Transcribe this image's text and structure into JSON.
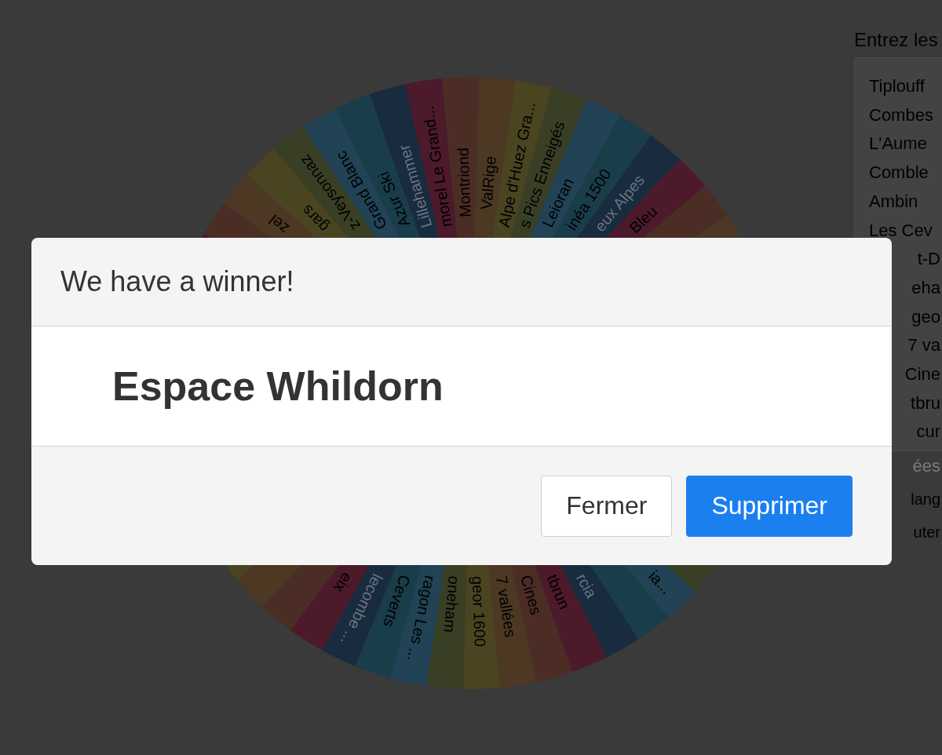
{
  "wheel": {
    "labels": [
      "zel",
      "gars",
      "z-Veysonnaz",
      "Grand Blanc",
      "Azur Ski",
      "Lillehammer",
      "morel Le Grand...",
      "Montriond",
      "ValRige",
      "Alpe d'Huez Gra...",
      "s Pics Enneigés",
      "Leioran",
      "inéa 1500",
      "eux Alpes",
      "Bleu",
      "eix",
      "lecombe ...",
      "Ceverts",
      "ragon Les ...",
      "oneham",
      "geor 1600",
      "7 vallées",
      "Cines",
      "tbrun",
      "rcia",
      "ia..."
    ]
  },
  "entries_panel": {
    "label": "Entrez les",
    "lines": [
      "Tiplouff",
      "Combes",
      "L'Aume",
      "Comble",
      "Ambin",
      "Les Cev",
      "t-D",
      "eha",
      "geo",
      "7 va",
      "Cine",
      "tbru",
      "cur"
    ],
    "hint": "ées",
    "options": [
      "lang",
      "uter"
    ]
  },
  "dialog": {
    "title": "We have a winner!",
    "winner": "Espace Whildorn",
    "buttons": [
      {
        "label": "Fermer",
        "kind": "secondary"
      },
      {
        "label": "Supprimer",
        "kind": "primary"
      }
    ]
  }
}
